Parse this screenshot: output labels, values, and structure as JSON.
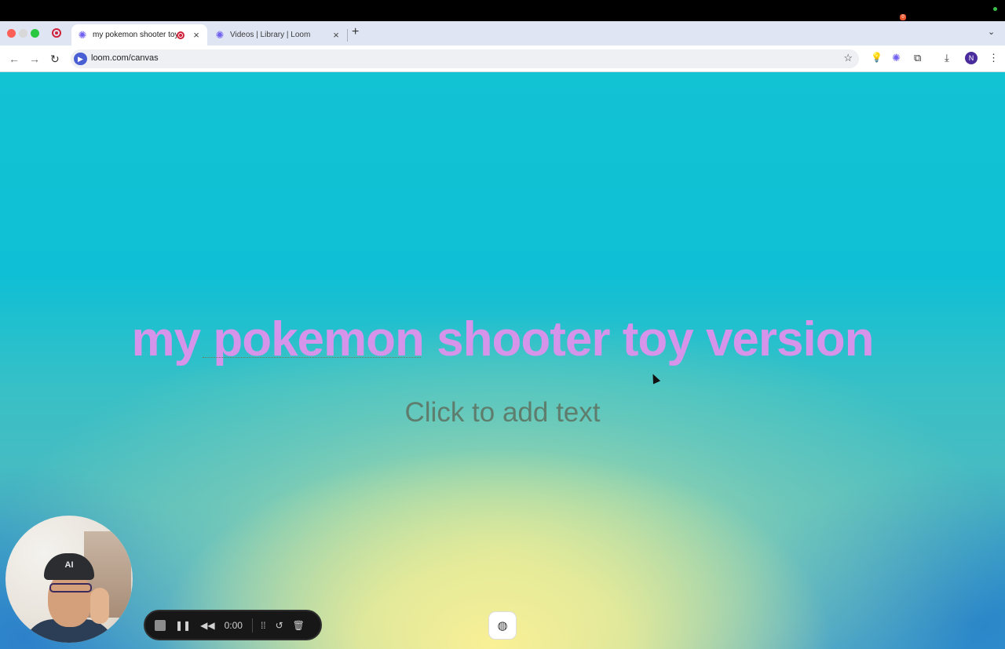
{
  "browser": {
    "tabs": [
      {
        "title": "my pokemon shooter toy version",
        "active": true,
        "recording": true
      },
      {
        "title": "Videos | Library | Loom",
        "active": false
      }
    ],
    "address": "loom.com/canvas",
    "profile_initial": "N",
    "extension_badge": "0"
  },
  "canvas": {
    "headline": "my pokemon shooter toy version",
    "placeholder": "Click to add text"
  },
  "recorder": {
    "timer": "0:00"
  },
  "icons": {
    "back": "←",
    "forward": "→",
    "reload": "↻",
    "star": "☆",
    "download": "⤓",
    "menu": "⋮",
    "close": "×",
    "plus": "+",
    "chevron": "⌄",
    "pause": "❚❚",
    "rewind": "◀◀",
    "grid": "⁞⁞",
    "restart": "↺",
    "trash": "🗑",
    "palette": "◍",
    "loom": "✺",
    "camera": "▶",
    "bulb": "💡",
    "puzzle": "⧉"
  }
}
